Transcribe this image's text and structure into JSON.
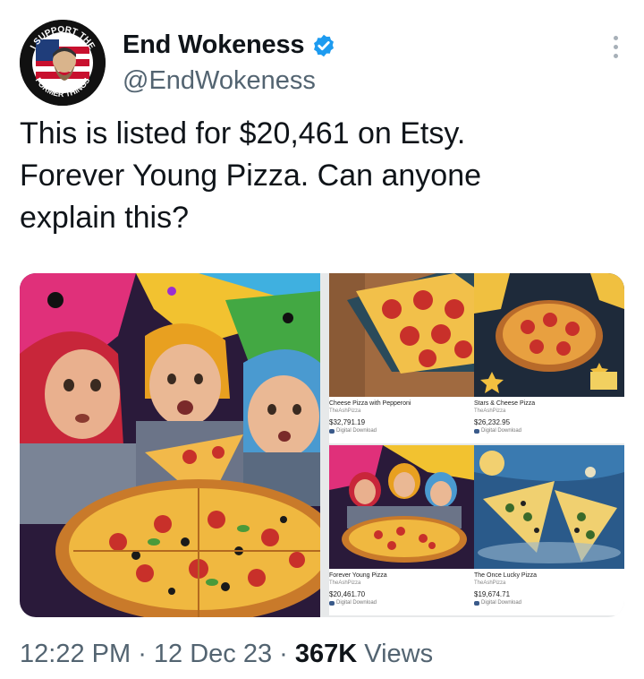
{
  "author": {
    "display_name": "End Wokeness",
    "handle": "@EndWokeness",
    "avatar_text_top": "I SUPPORT THE",
    "avatar_text_bottom": "FORMER THINGS",
    "verified_color": "#1d9bf0"
  },
  "tweet": {
    "text": "This is listed for $20,461 on Etsy.\nForever Young Pizza. Can anyone\nexplain this?"
  },
  "listings": [
    {
      "title": "Cheese Pizza with Pepperoni",
      "shop": "TheAshPizza",
      "price": "$32,791.19",
      "badge": "Digital Download"
    },
    {
      "title": "Stars & Cheese Pizza",
      "shop": "TheAshPizza",
      "price": "$26,232.95",
      "badge": "Digital Download"
    },
    {
      "title": "Forever Young Pizza",
      "shop": "TheAshPizza",
      "price": "$20,461.70",
      "badge": "Digital Download"
    },
    {
      "title": "The Once Lucky Pizza",
      "shop": "TheAshPizza",
      "price": "$19,674.71",
      "badge": "Digital Download"
    }
  ],
  "footer": {
    "time": "12:22 PM",
    "sep1": " · ",
    "date": "12 Dec 23",
    "sep2": " · ",
    "views_count": "367K",
    "views_label": " Views"
  },
  "icons": {
    "verified": "verified-badge-icon",
    "more": "more-options-icon",
    "download": "download-icon"
  }
}
